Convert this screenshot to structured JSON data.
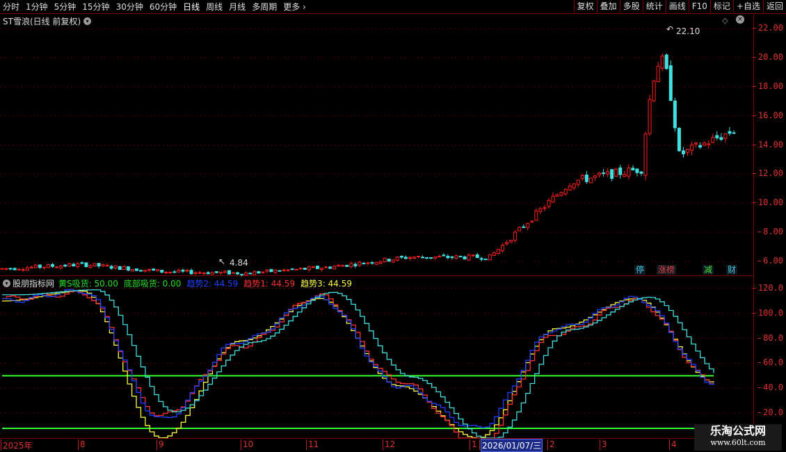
{
  "toolbar": {
    "periods": [
      {
        "label": "分时",
        "active": false
      },
      {
        "label": "1分钟",
        "active": false
      },
      {
        "label": "5分钟",
        "active": false
      },
      {
        "label": "15分钟",
        "active": false
      },
      {
        "label": "30分钟",
        "active": false
      },
      {
        "label": "60分钟",
        "active": false
      },
      {
        "label": "日线",
        "active": true
      },
      {
        "label": "周线",
        "active": false
      },
      {
        "label": "月线",
        "active": false
      },
      {
        "label": "多周期",
        "active": false
      },
      {
        "label": "更多",
        "active": false
      }
    ],
    "buttons": [
      "复权",
      "叠加",
      "多股",
      "统计",
      "画线",
      "F10",
      "标记",
      "+自选",
      "返回"
    ]
  },
  "price_pane": {
    "title": "ST雪浪(日线 前复权)",
    "high_label": "22.10",
    "low_label": "4.84",
    "badges": [
      {
        "text": "停",
        "color": "#40c8e0"
      },
      {
        "text": "涨榜",
        "color": "#e04040"
      },
      {
        "text": "减",
        "color": "#40e040"
      },
      {
        "text": "财",
        "color": "#40c8e0"
      }
    ]
  },
  "indicator": {
    "name": "股朋指标网",
    "legend": [
      {
        "label": "黄S吸货: 50.00",
        "color": "#20e020"
      },
      {
        "label": "底部吸货: 0.00",
        "color": "#20e020"
      },
      {
        "label": "趋势2: 44.59",
        "color": "#2040ff"
      },
      {
        "label": "趋势1: 44.59",
        "color": "#ff3030"
      },
      {
        "label": "趋势3: 44.59",
        "color": "#ffff40"
      }
    ]
  },
  "xaxis": {
    "labels": [
      "2025年",
      "8",
      "9",
      "10",
      "11",
      "12",
      "1",
      "2026/01/07/三",
      "2",
      "3",
      "4"
    ]
  },
  "watermark": {
    "title": "乐淘公式网",
    "url": "www.60lt.com"
  },
  "colors": {
    "up": "#ff2020",
    "down": "#40e0e0",
    "axis": "#e03030",
    "frame": "#7a0000"
  },
  "chart_data": [
    {
      "type": "candlestick",
      "title": "ST雪浪(日线 前复权)",
      "ylim": [
        5.0,
        23.0
      ],
      "yticks": [
        6.0,
        8.0,
        10.0,
        12.0,
        14.0,
        16.0,
        18.0,
        20.0,
        22.0
      ],
      "x": [
        "2025-07",
        "2025-08",
        "2025-09",
        "2025-10",
        "2025-11",
        "2025-12",
        "2026-01",
        "2026-02",
        "2026-03",
        "2026-04"
      ],
      "close_approx": [
        5.5,
        5.8,
        5.3,
        5.2,
        5.6,
        6.3,
        6.3,
        11.5,
        12.5,
        15.0
      ],
      "max": 22.1,
      "min": 4.84
    },
    {
      "type": "line",
      "title": "股朋指标网",
      "ylim": [
        0,
        130
      ],
      "yticks": [
        20.0,
        40.0,
        60.0,
        80.0,
        100.0,
        120.0
      ],
      "x": [
        "2025-07",
        "2025-08",
        "2025-09",
        "2025-10",
        "2025-11",
        "2025-12",
        "2026-01",
        "2026-02",
        "2026-03",
        "2026-04"
      ],
      "series": [
        {
          "name": "黄S吸货",
          "values": [
            50,
            50,
            50,
            50,
            50,
            50,
            50,
            50,
            50,
            50
          ]
        },
        {
          "name": "底部吸货",
          "values": [
            0,
            0,
            0,
            0,
            0,
            0,
            0,
            0,
            0,
            0
          ]
        },
        {
          "name": "趋势1",
          "values": [
            110,
            118,
            15,
            78,
            112,
            42,
            8,
            88,
            112,
            44.59
          ]
        },
        {
          "name": "趋势2",
          "values": [
            112,
            116,
            18,
            74,
            114,
            46,
            -5,
            84,
            110,
            44.59
          ]
        },
        {
          "name": "趋势3",
          "values": [
            110,
            118,
            0,
            78,
            112,
            42,
            0,
            88,
            112,
            44.59
          ]
        }
      ]
    }
  ]
}
